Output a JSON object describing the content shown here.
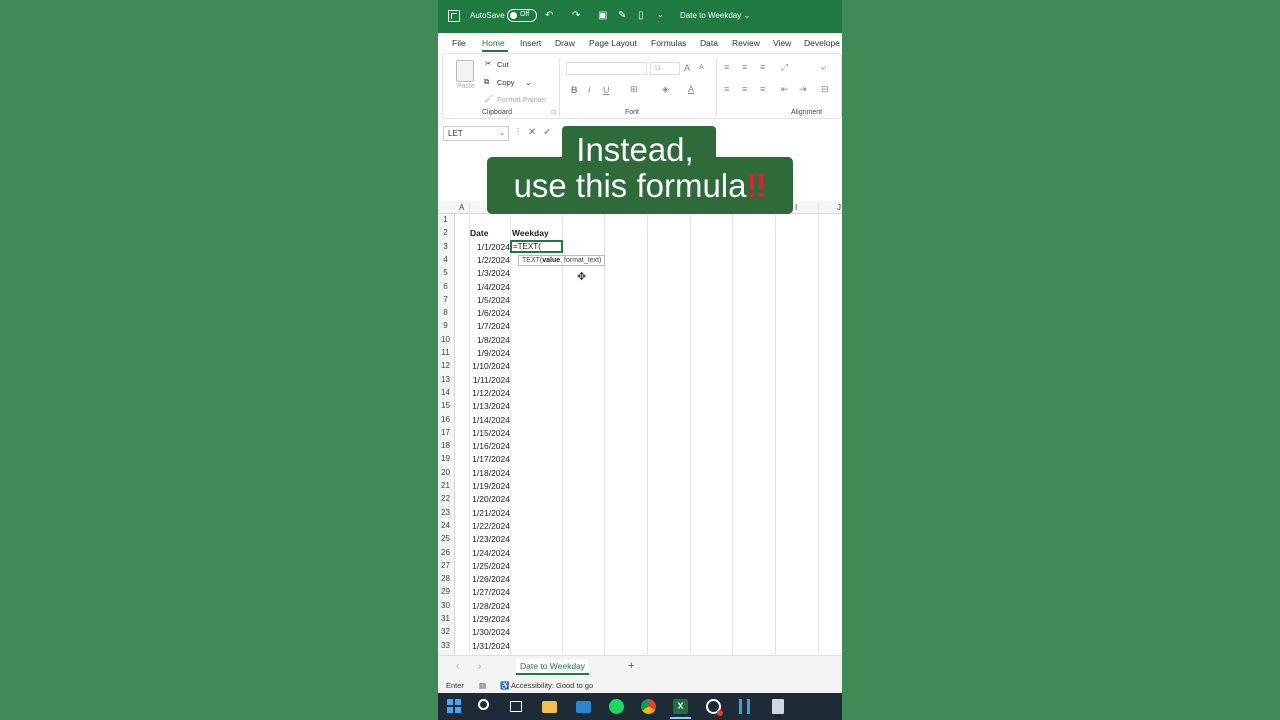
{
  "titlebar": {
    "autosave_label": "AutoSave",
    "autosave_state": "Off",
    "doc_title": "Date to Weekday ⌄",
    "icons": [
      "excel-icon",
      "undo-icon",
      "redo-icon",
      "save-icon",
      "touch-mode-icon",
      "new-icon",
      "more-icon"
    ]
  },
  "ribbon_tabs": [
    "File",
    "Home",
    "Insert",
    "Draw",
    "Page Layout",
    "Formulas",
    "Data",
    "Review",
    "View",
    "Develope"
  ],
  "ribbon": {
    "clipboard": {
      "paste": "Paste",
      "cut": "Cut",
      "copy": "Copy",
      "format_painter": "Format Painter",
      "group_label": "Clipboard"
    },
    "font": {
      "font_size": "11",
      "group_label": "Font"
    },
    "alignment": {
      "group_label": "Alignment"
    }
  },
  "formula_bar": {
    "name_box": "LET"
  },
  "overlay": {
    "line1": "Instead,",
    "line2": "use this formula",
    "emphasis": "‼"
  },
  "grid": {
    "columns": [
      "A",
      "I",
      "J"
    ],
    "header_date": "Date",
    "header_weekday": "Weekday",
    "active_cell_text": "=TEXT(",
    "tooltip_func": "TEXT(",
    "tooltip_bold": "value",
    "tooltip_rest": ", format_text)",
    "row_numbers": [
      "1",
      "2",
      "3",
      "4",
      "5",
      "6",
      "7",
      "8",
      "9",
      "10",
      "11",
      "12",
      "13",
      "14",
      "15",
      "16",
      "17",
      "18",
      "19",
      "20",
      "21",
      "22",
      "23",
      "24",
      "25",
      "26",
      "27",
      "28",
      "29",
      "30",
      "31",
      "32",
      "33"
    ],
    "dates": [
      "1/1/2024",
      "1/2/2024",
      "1/3/2024",
      "1/4/2024",
      "1/5/2024",
      "1/6/2024",
      "1/7/2024",
      "1/8/2024",
      "1/9/2024",
      "1/10/2024",
      "1/11/2024",
      "1/12/2024",
      "1/13/2024",
      "1/14/2024",
      "1/15/2024",
      "1/16/2024",
      "1/17/2024",
      "1/18/2024",
      "1/19/2024",
      "1/20/2024",
      "1/21/2024",
      "1/22/2024",
      "1/23/2024",
      "1/24/2024",
      "1/25/2024",
      "1/26/2024",
      "1/27/2024",
      "1/28/2024",
      "1/29/2024",
      "1/30/2024",
      "1/31/2024"
    ]
  },
  "sheet_tabs": {
    "active": "Date to Weekday",
    "add": "+"
  },
  "status_bar": {
    "mode": "Enter",
    "accessibility": "Accessibility: Good to go"
  },
  "taskbar": {
    "icons": [
      "windows-icon",
      "search-icon",
      "task-view-icon",
      "file-explorer-icon",
      "mail-icon",
      "spotify-icon",
      "chrome-icon",
      "excel-icon",
      "obs-icon",
      "app-icon",
      "calculator-icon"
    ]
  },
  "colors": {
    "excel_green": "#1f7a42",
    "background": "#3f8a57",
    "overlay_bg": "#2f6a3b",
    "emphasis_red": "#d8232a"
  }
}
